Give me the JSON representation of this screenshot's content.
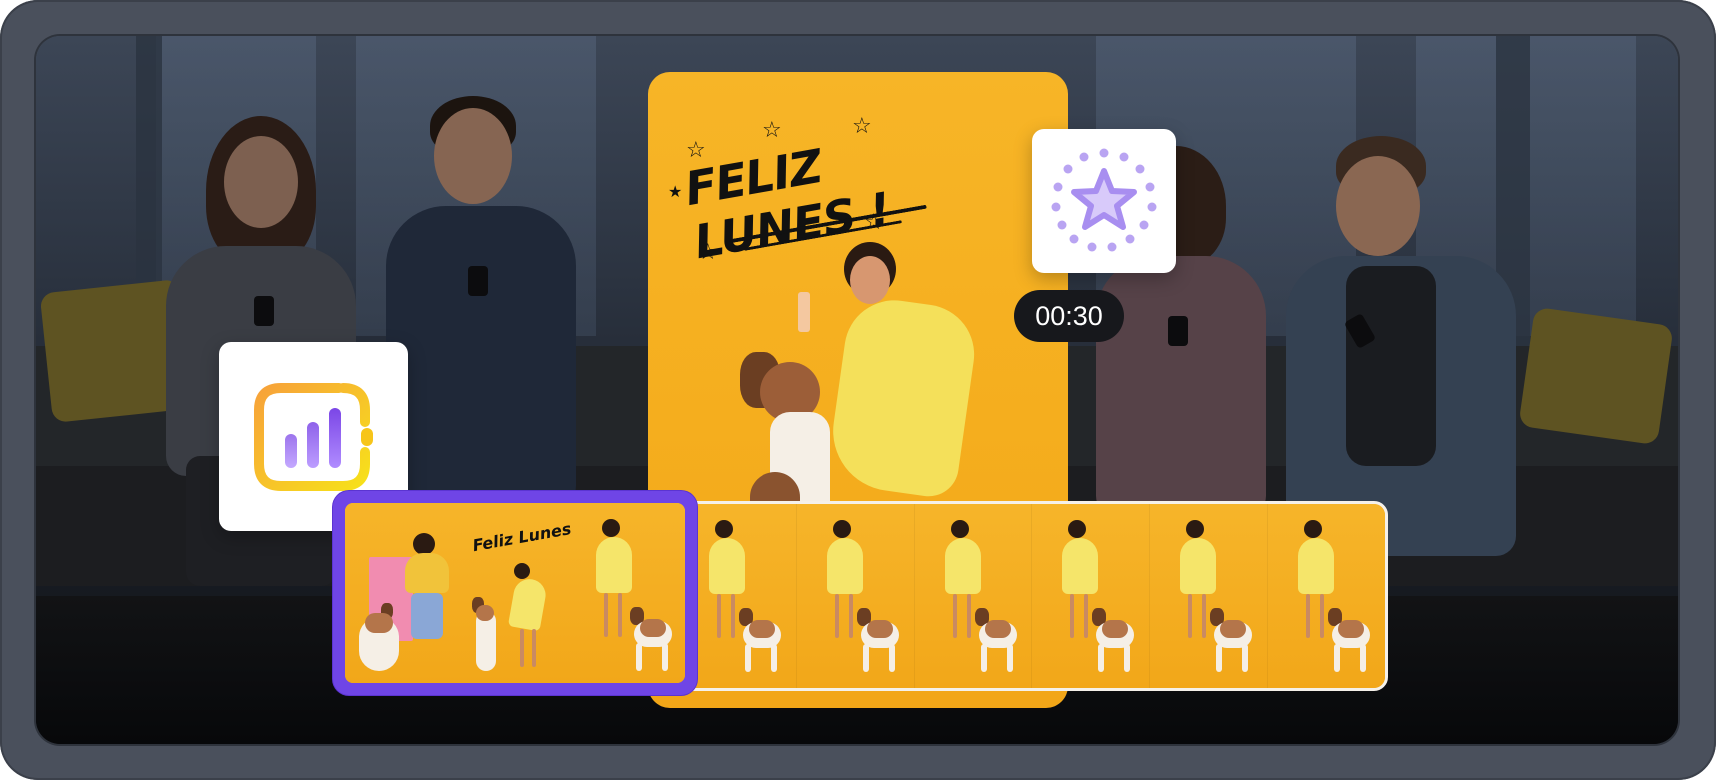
{
  "story": {
    "title": "Feliz Lunes",
    "exclaim": "!"
  },
  "timeline": {
    "duration": "00:30",
    "frame_count": 6,
    "selected_frame_count": 3
  },
  "icons": {
    "analytics": "bar-chart-icon",
    "effects": "sparkle-star-icon"
  },
  "colors": {
    "accent": "#6f45e6",
    "story_bg": "#f5ae1e",
    "badge_bg": "#17181c",
    "frame_border": "#f5f1ea"
  }
}
